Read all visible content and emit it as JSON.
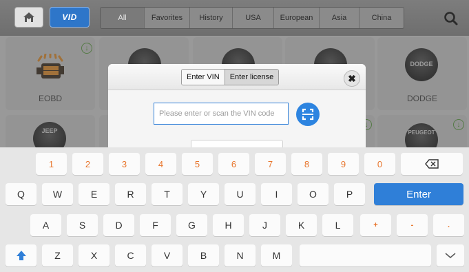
{
  "header": {
    "home_icon": "home-icon",
    "vid_label": "VID",
    "tabs": [
      {
        "label": "All"
      },
      {
        "label": "Favorites"
      },
      {
        "label": "History"
      },
      {
        "label": "USA"
      },
      {
        "label": "European"
      },
      {
        "label": "Asia"
      },
      {
        "label": "China"
      }
    ],
    "active_tab": "All",
    "search_icon": "search-icon"
  },
  "grid": {
    "tiles": [
      {
        "label": "EOBD",
        "logo_text": "CHECK ENGINE"
      },
      {
        "label": "DODGE",
        "logo_text": "DODGE"
      },
      {
        "label": "",
        "logo_text": "JEEP"
      },
      {
        "label": "",
        "logo_text": "PEUGEOT"
      }
    ]
  },
  "dialog": {
    "tabs": [
      {
        "label": "Enter VIN"
      },
      {
        "label": "Enter license"
      }
    ],
    "active_tab": "Enter VIN",
    "vin_placeholder": "Please enter or scan the VIN code",
    "vin_value": "",
    "close_icon": "close-icon",
    "scan_icon": "scan-icon"
  },
  "keyboard": {
    "row1": [
      "1",
      "2",
      "3",
      "4",
      "5",
      "6",
      "7",
      "8",
      "9",
      "0"
    ],
    "row2": [
      "Q",
      "W",
      "E",
      "R",
      "T",
      "Y",
      "U",
      "I",
      "O",
      "P"
    ],
    "row3": [
      "A",
      "S",
      "D",
      "F",
      "G",
      "H",
      "J",
      "K",
      "L",
      "+",
      "-",
      "."
    ],
    "row4": [
      "Z",
      "X",
      "C",
      "V",
      "B",
      "N",
      "M"
    ],
    "enter_label": "Enter",
    "colors": {
      "accent": "#2f7fd8",
      "number": "#e8752c"
    }
  }
}
